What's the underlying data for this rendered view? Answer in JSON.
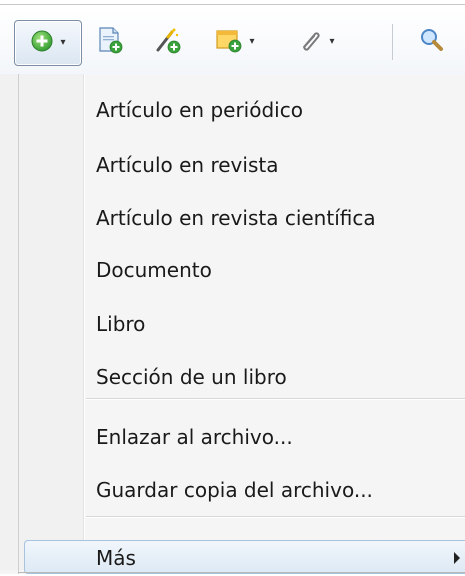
{
  "toolbar": {
    "buttons": [
      {
        "name": "new-item",
        "icon": "green-plus-circle-icon",
        "has_dropdown": true
      },
      {
        "name": "new-note-document",
        "icon": "document-add-icon",
        "has_dropdown": false
      },
      {
        "name": "add-by-identifier",
        "icon": "magic-wand-add-icon",
        "has_dropdown": false
      },
      {
        "name": "new-note",
        "icon": "yellow-note-add-icon",
        "has_dropdown": true
      },
      {
        "name": "add-attachment",
        "icon": "paperclip-icon",
        "has_dropdown": true
      },
      {
        "name": "search",
        "icon": "magnifier-icon",
        "has_dropdown": false
      }
    ]
  },
  "menu": {
    "items": [
      {
        "label": "Artículo en periódico"
      },
      {
        "label": "Artículo en revista"
      },
      {
        "label": "Artículo en revista científica"
      },
      {
        "label": "Documento"
      },
      {
        "label": "Libro"
      },
      {
        "label": "Sección de un libro"
      }
    ],
    "file_items": [
      {
        "label": "Enlazar al archivo..."
      },
      {
        "label": "Guardar copia del archivo..."
      }
    ],
    "more": {
      "label": "Más",
      "has_submenu": true
    }
  },
  "colors": {
    "highlight_border": "#a7c3dd",
    "highlight_fill": "#dde9f5",
    "green_icon": "#3aa23a"
  }
}
